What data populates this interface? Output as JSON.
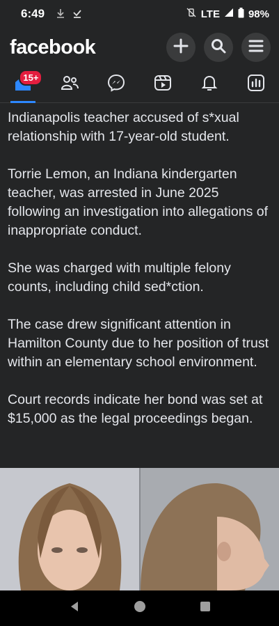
{
  "status_bar": {
    "time": "6:49",
    "network": "LTE",
    "battery": "98%"
  },
  "header": {
    "logo": "facebook",
    "actions": [
      "plus-icon",
      "search-icon",
      "menu-icon"
    ]
  },
  "nav": {
    "items": [
      "home",
      "friends",
      "messenger",
      "reels",
      "notifications",
      "dashboard"
    ],
    "badge": "15+"
  },
  "post": {
    "paragraphs": [
      "Indianapolis teacher accused of s*xual relationship with 17-year-old student.",
      "Torrie Lemon, an Indiana kindergarten teacher, was arrested in June 2025 following an investigation into allegations of inappropriate conduct.",
      "She was charged with multiple felony counts, including child sed*ction.",
      "The case drew significant attention in Hamilton County due to her position of trust within an elementary school environment.",
      "Court records indicate her bond was set at $15,000 as the legal proceedings began."
    ]
  },
  "colors": {
    "background": "#242526",
    "accent": "#2d88ff",
    "badge": "#e41e3f"
  }
}
